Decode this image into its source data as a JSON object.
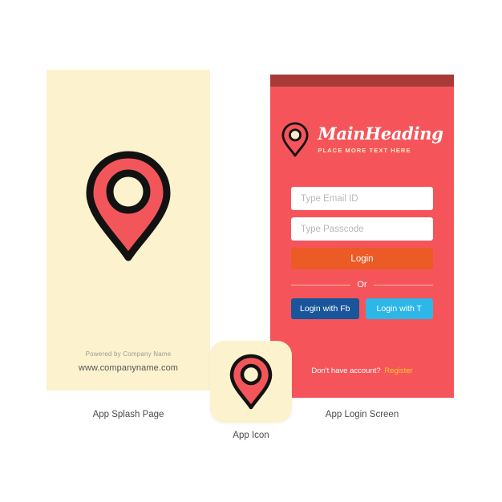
{
  "splash": {
    "powered_by": "Powered by Company Name",
    "website": "www.companyname.com",
    "caption": "App Splash Page",
    "background_color": "#FCF2CD",
    "pin_icon": "location-pin-icon"
  },
  "app_icon": {
    "caption": "App Icon",
    "background_color": "#FCF2CD",
    "pin_icon": "location-pin-icon"
  },
  "login": {
    "caption": "App Login Screen",
    "background_color": "#F5555A",
    "status_bar_color": "#A83A38",
    "logo_icon": "location-pin-icon",
    "main_heading": "MainHeading",
    "sub_heading": "PLACE MORE TEXT HERE",
    "email_placeholder": "Type Email ID",
    "email_value": "",
    "passcode_placeholder": "Type Passcode",
    "passcode_value": "",
    "login_label": "Login",
    "login_color": "#EC5A26",
    "or_label": "Or",
    "facebook_label": "Login with Fb",
    "facebook_color": "#18559A",
    "twitter_label": "Login with T",
    "twitter_color": "#2DB6E8",
    "register_prompt": "Don't have account?",
    "register_label": "Register",
    "register_color": "#FFC629"
  }
}
